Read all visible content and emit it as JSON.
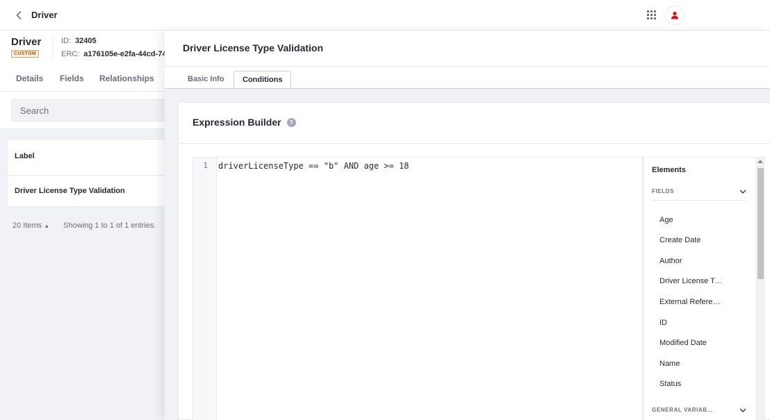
{
  "topbar": {
    "title": "Driver",
    "back_icon": "chevron-left-icon",
    "apps_icon": "apps-grid-icon",
    "user_icon": "user-icon",
    "user_color": "#da1414"
  },
  "object": {
    "name": "Driver",
    "badge": "CUSTOM",
    "id_label": "ID:",
    "id_value": "32405",
    "erc_label": "ERC:",
    "erc_value": "a176105e-e2fa-44cd-74"
  },
  "left_tabs": [
    "Details",
    "Fields",
    "Relationships"
  ],
  "search": {
    "placeholder": "Search"
  },
  "table": {
    "header": "Label",
    "rows": [
      "Driver License Type Validation"
    ]
  },
  "pagination": {
    "items": "20 Items",
    "showing": "Showing 1 to 1 of 1 entries."
  },
  "panel": {
    "title": "Driver License Type Validation",
    "tabs": [
      {
        "label": "Basic Info",
        "active": false
      },
      {
        "label": "Conditions",
        "active": true
      }
    ]
  },
  "expression_builder": {
    "title": "Expression Builder",
    "help_icon": "question-circle-icon",
    "line_number": "1",
    "code": "driverLicenseType == \"b\" AND age >= 18"
  },
  "elements": {
    "title": "Elements",
    "sections": [
      {
        "label": "FIELDS",
        "items": [
          "Age",
          "Create Date",
          "Author",
          "Driver License T…",
          "External Refere…",
          "ID",
          "Modified Date",
          "Name",
          "Status"
        ]
      },
      {
        "label": "GENERAL VARIAB…",
        "items": []
      }
    ]
  },
  "colors": {
    "accent": "#0b5fff",
    "badge_text": "#b95000",
    "background": "#f1f2f5"
  }
}
